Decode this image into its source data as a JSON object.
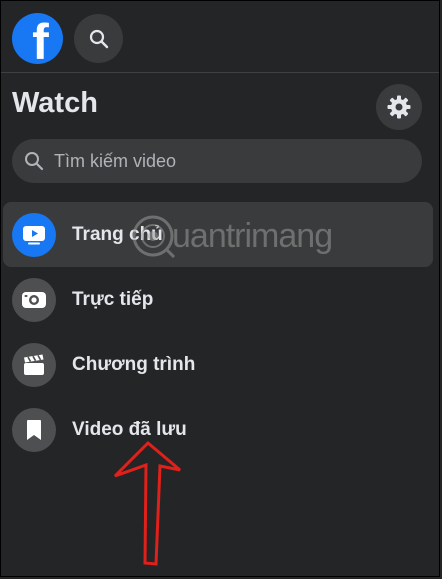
{
  "header": {
    "logo_letter": "f",
    "logo_icon": "facebook-logo-icon",
    "search_icon": "search-icon"
  },
  "watch": {
    "title": "Watch",
    "settings_icon": "gear-icon",
    "search": {
      "placeholder": "Tìm kiếm video",
      "value": ""
    }
  },
  "nav": {
    "items": [
      {
        "label": "Trang chủ",
        "icon": "play-screen-icon",
        "active": true
      },
      {
        "label": "Trực tiếp",
        "icon": "live-camera-icon",
        "active": false
      },
      {
        "label": "Chương trình",
        "icon": "clapperboard-icon",
        "active": false
      },
      {
        "label": "Video đã lưu",
        "icon": "bookmark-icon",
        "active": false
      }
    ]
  },
  "watermark": {
    "text": "uantrimang"
  },
  "colors": {
    "background": "#242526",
    "surface": "#3a3b3c",
    "accent": "#1877f2",
    "text": "#e4e6eb",
    "arrow": "#e0201b"
  }
}
